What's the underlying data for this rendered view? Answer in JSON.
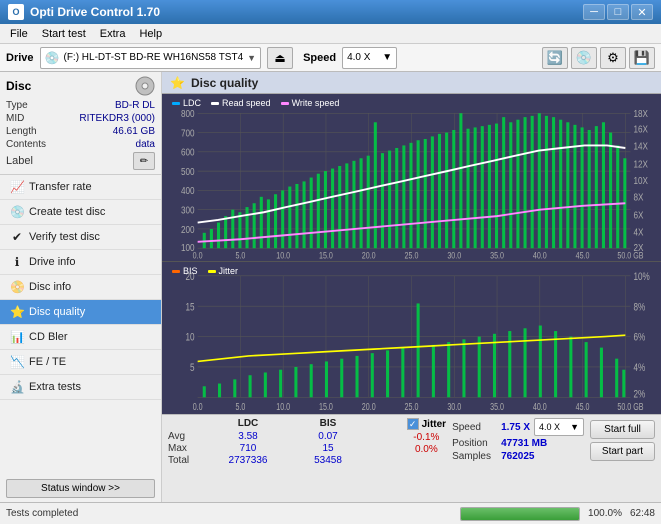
{
  "titleBar": {
    "title": "Opti Drive Control 1.70",
    "minBtn": "─",
    "maxBtn": "□",
    "closeBtn": "✕"
  },
  "menuBar": {
    "items": [
      "File",
      "Start test",
      "Extra",
      "Help"
    ]
  },
  "driveBar": {
    "label": "Drive",
    "driveText": "(F:)  HL-DT-ST BD-RE  WH16NS58 TST4",
    "speedLabel": "Speed",
    "speedValue": "4.0 X"
  },
  "discInfo": {
    "sectionLabel": "Disc",
    "rows": [
      {
        "label": "Type",
        "value": "BD-R DL"
      },
      {
        "label": "MID",
        "value": "RITEKDR3 (000)"
      },
      {
        "label": "Length",
        "value": "46.61 GB"
      },
      {
        "label": "Contents",
        "value": "data"
      },
      {
        "label": "Label",
        "value": ""
      }
    ]
  },
  "sidebar": {
    "items": [
      {
        "id": "transfer-rate",
        "label": "Transfer rate",
        "icon": "📈"
      },
      {
        "id": "create-test-disc",
        "label": "Create test disc",
        "icon": "💿"
      },
      {
        "id": "verify-test-disc",
        "label": "Verify test disc",
        "icon": "✔"
      },
      {
        "id": "drive-info",
        "label": "Drive info",
        "icon": "ℹ"
      },
      {
        "id": "disc-info",
        "label": "Disc info",
        "icon": "📀"
      },
      {
        "id": "disc-quality",
        "label": "Disc quality",
        "icon": "⭐",
        "active": true
      },
      {
        "id": "cd-bler",
        "label": "CD Bler",
        "icon": "📊"
      },
      {
        "id": "fe-te",
        "label": "FE / TE",
        "icon": "📉"
      },
      {
        "id": "extra-tests",
        "label": "Extra tests",
        "icon": "🔬"
      }
    ],
    "statusBtn": "Status window >>"
  },
  "contentHeader": {
    "title": "Disc quality",
    "icon": "⭐"
  },
  "chart1": {
    "legend": [
      {
        "label": "LDC",
        "color": "#00aaff"
      },
      {
        "label": "Read speed",
        "color": "#ffffff"
      },
      {
        "label": "Write speed",
        "color": "#ff88ff"
      }
    ],
    "yAxisLeft": [
      "800",
      "700",
      "600",
      "500",
      "400",
      "300",
      "200",
      "100"
    ],
    "yAxisRight": [
      "18X",
      "16X",
      "14X",
      "12X",
      "10X",
      "8X",
      "6X",
      "4X",
      "2X"
    ],
    "xAxis": [
      "0.0",
      "5.0",
      "10.0",
      "15.0",
      "20.0",
      "25.0",
      "30.0",
      "35.0",
      "40.0",
      "45.0",
      "50.0 GB"
    ]
  },
  "chart2": {
    "legend": [
      {
        "label": "BIS",
        "color": "#ff6600"
      },
      {
        "label": "Jitter",
        "color": "#ffff00"
      }
    ],
    "yAxisLeft": [
      "20",
      "15",
      "10",
      "5"
    ],
    "yAxisRight": [
      "10%",
      "8%",
      "6%",
      "4%",
      "2%"
    ],
    "xAxis": [
      "0.0",
      "5.0",
      "10.0",
      "15.0",
      "20.0",
      "25.0",
      "30.0",
      "35.0",
      "40.0",
      "45.0",
      "50.0 GB"
    ]
  },
  "stats": {
    "columns": [
      "LDC",
      "BIS"
    ],
    "rows": [
      {
        "label": "Avg",
        "ldc": "3.58",
        "bis": "0.07"
      },
      {
        "label": "Max",
        "ldc": "710",
        "bis": "15"
      },
      {
        "label": "Total",
        "ldc": "2737336",
        "bis": "53458"
      }
    ],
    "jitter": {
      "label": "Jitter",
      "checked": true,
      "values": [
        "-0.1%",
        "0.0%",
        ""
      ]
    },
    "speed": {
      "speedLabel": "Speed",
      "speedValue": "1.75 X",
      "speedMax": "4.0 X",
      "positionLabel": "Position",
      "positionValue": "47731 MB",
      "samplesLabel": "Samples",
      "samplesValue": "762025"
    },
    "buttons": {
      "startFull": "Start full",
      "startPart": "Start part"
    }
  },
  "statusBar": {
    "text": "Tests completed",
    "progress": 100,
    "progressText": "100.0%",
    "time": "62:48"
  }
}
